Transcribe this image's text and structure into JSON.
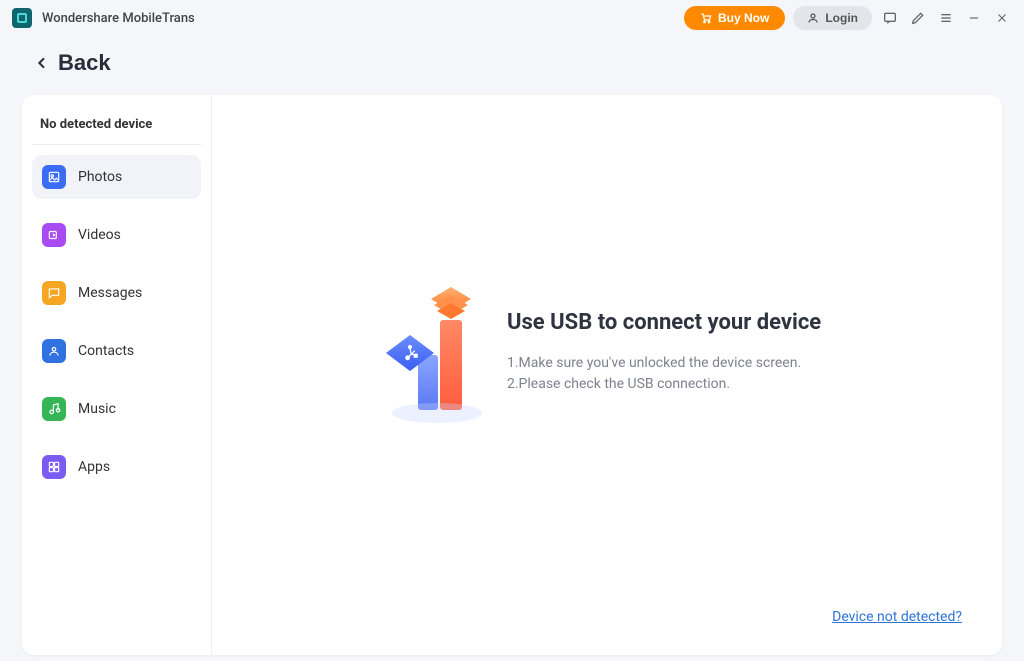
{
  "titlebar": {
    "app_name": "Wondershare MobileTrans",
    "buy_label": "Buy Now",
    "login_label": "Login"
  },
  "back_label": "Back",
  "sidebar": {
    "heading": "No detected device",
    "items": [
      {
        "label": "Photos",
        "color": "#3b6cf6"
      },
      {
        "label": "Videos",
        "color": "#a94bf2"
      },
      {
        "label": "Messages",
        "color": "#f5a623"
      },
      {
        "label": "Contacts",
        "color": "#2f72e0"
      },
      {
        "label": "Music",
        "color": "#35b556"
      },
      {
        "label": "Apps",
        "color": "#7a5cf0"
      }
    ]
  },
  "main": {
    "title": "Use USB to connect your device",
    "step1": "1.Make sure you've unlocked the device screen.",
    "step2": "2.Please check the USB connection.",
    "help_link": "Device not detected?"
  }
}
